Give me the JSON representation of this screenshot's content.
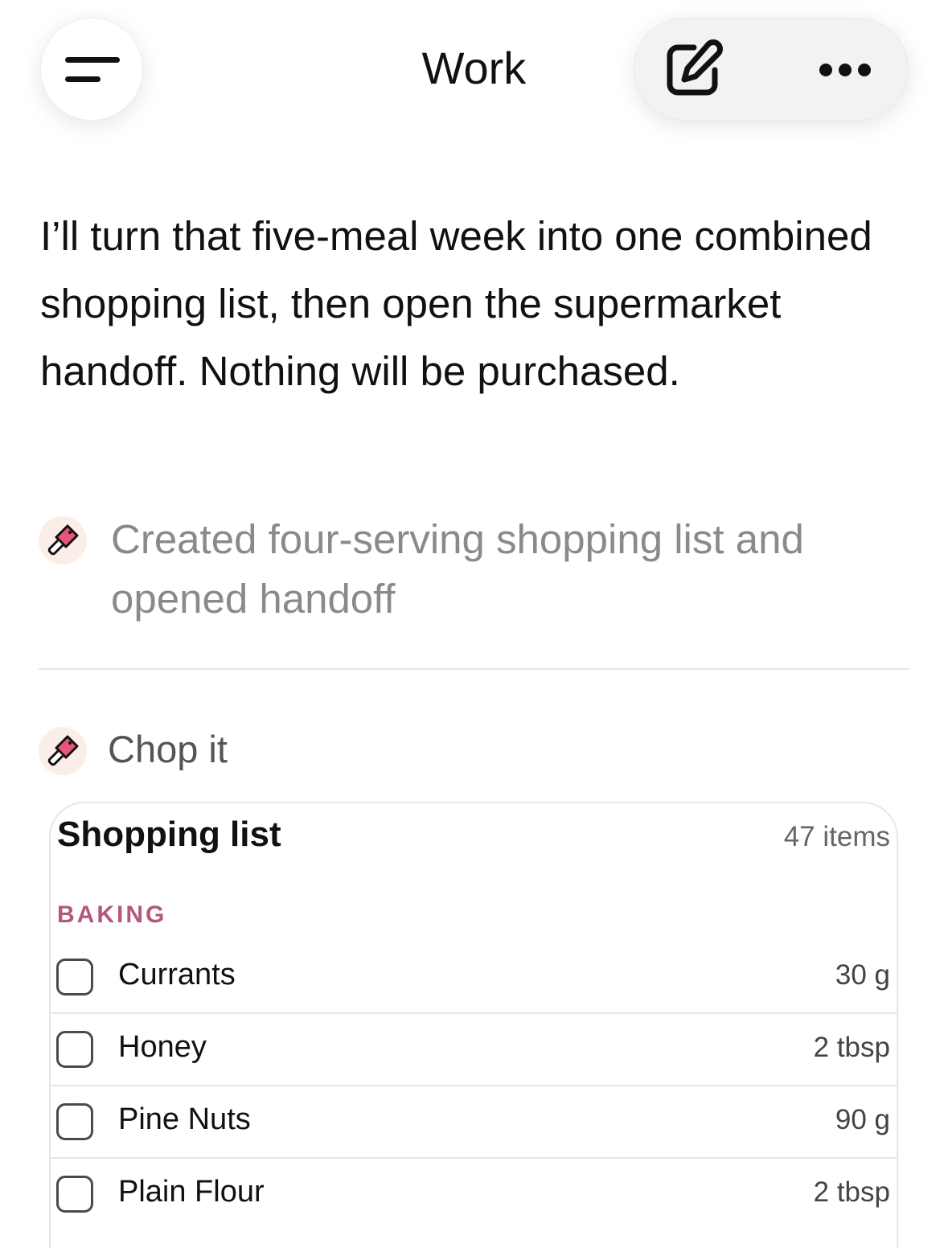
{
  "header": {
    "title": "Work",
    "menu_icon": "hamburger-menu-icon",
    "edit_icon": "compose-edit-icon",
    "more_icon": "more-horizontal-icon"
  },
  "message": {
    "text": "I’ll turn that five-meal week into one combined shopping list, then open the supermarket handoff. Nothing will be purchased."
  },
  "status": {
    "icon": "cleaver-icon",
    "text": "Created four-serving shopping list and opened handoff"
  },
  "app": {
    "icon": "cleaver-icon",
    "name": "Chop it"
  },
  "card": {
    "title": "Shopping list",
    "count": "47 items",
    "sections": [
      {
        "label": "BAKING",
        "items": [
          {
            "name": "Currants",
            "qty": "30 g"
          },
          {
            "name": "Honey",
            "qty": "2 tbsp"
          },
          {
            "name": "Pine Nuts",
            "qty": "90 g"
          },
          {
            "name": "Plain Flour",
            "qty": "2 tbsp"
          }
        ]
      }
    ]
  },
  "colors": {
    "accent_section": "#b3577e",
    "status_text": "#8a8a8a",
    "icon_bg": "#fbeee6",
    "cleaver_blade": "#e8557a"
  }
}
